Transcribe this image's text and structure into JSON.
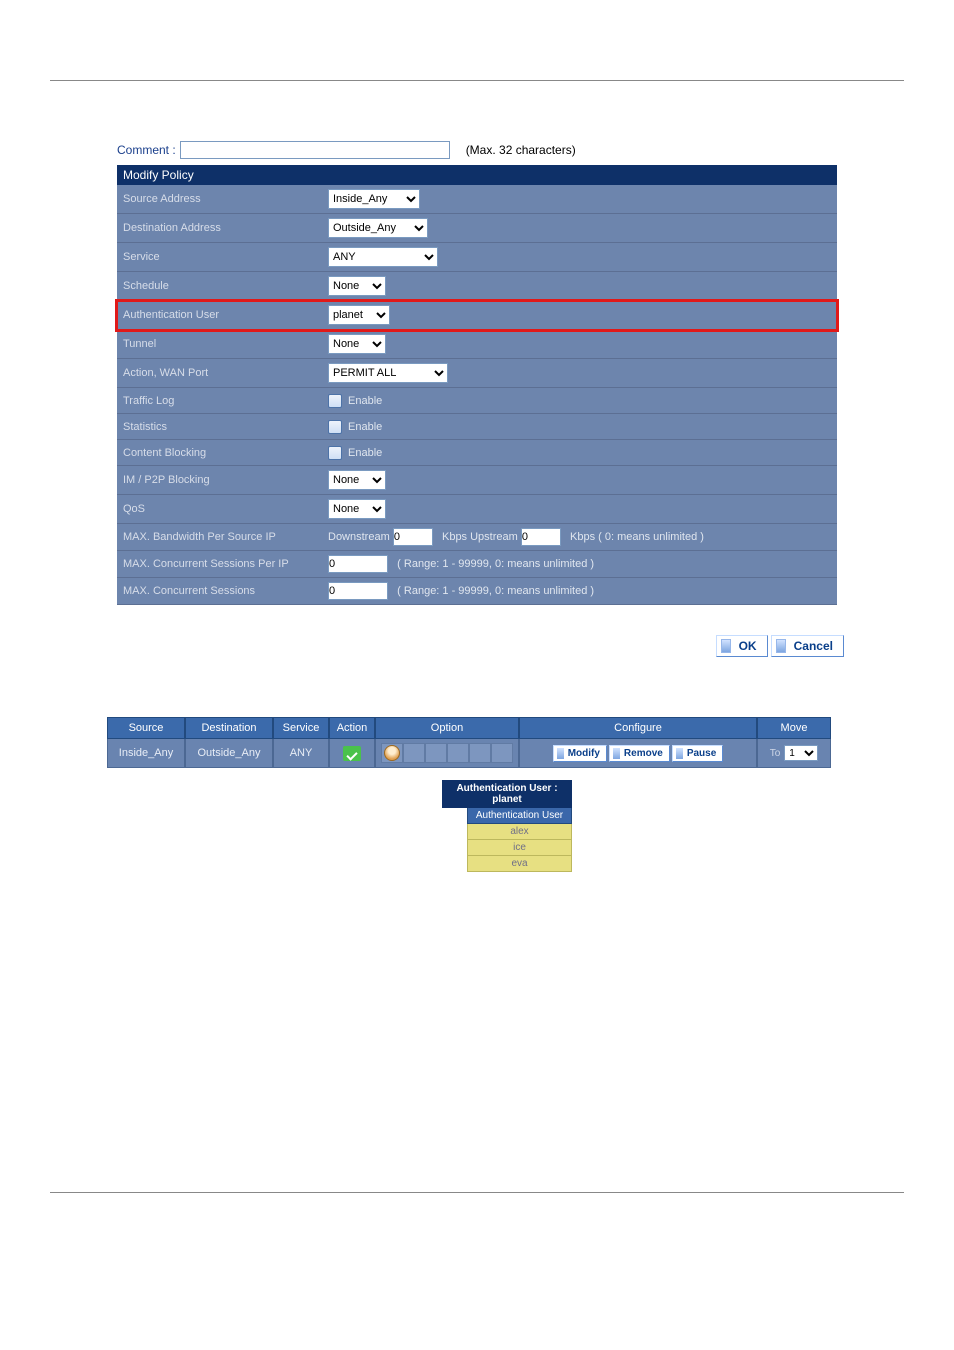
{
  "comment": {
    "label": "Comment :",
    "value": "",
    "hint": "(Max. 32 characters)"
  },
  "header": "Modify Policy",
  "fields": {
    "source_address": {
      "label": "Source Address",
      "value": "Inside_Any"
    },
    "destination_address": {
      "label": "Destination Address",
      "value": "Outside_Any"
    },
    "service": {
      "label": "Service",
      "value": "ANY"
    },
    "schedule": {
      "label": "Schedule",
      "value": "None"
    },
    "auth_user": {
      "label": "Authentication User",
      "value": "planet"
    },
    "tunnel": {
      "label": "Tunnel",
      "value": "None"
    },
    "action_wan": {
      "label": "Action, WAN Port",
      "value": "PERMIT ALL"
    },
    "traffic_log": {
      "label": "Traffic Log",
      "check_label": "Enable"
    },
    "statistics": {
      "label": "Statistics",
      "check_label": "Enable"
    },
    "content_blocking": {
      "label": "Content Blocking",
      "check_label": "Enable"
    },
    "im_p2p": {
      "label": "IM / P2P Blocking",
      "value": "None"
    },
    "qos": {
      "label": "QoS",
      "value": "None"
    },
    "max_bw": {
      "label": "MAX. Bandwidth Per Source IP",
      "down_label": "Downstream",
      "down_val": "0",
      "up_label": "Kbps Upstream",
      "up_val": "0",
      "suffix": "Kbps ( 0: means unlimited )"
    },
    "max_sess_ip": {
      "label": "MAX. Concurrent Sessions Per IP",
      "value": "0",
      "hint": "( Range: 1 - 99999, 0: means unlimited )"
    },
    "max_sess": {
      "label": "MAX. Concurrent Sessions",
      "value": "0",
      "hint": "( Range: 1 - 99999, 0: means unlimited )"
    }
  },
  "buttons": {
    "ok": "OK",
    "cancel": "Cancel"
  },
  "policy_table": {
    "headers": {
      "source": "Source",
      "destination": "Destination",
      "service": "Service",
      "action": "Action",
      "option": "Option",
      "configure": "Configure",
      "move": "Move"
    },
    "row": {
      "source": "Inside_Any",
      "destination": "Outside_Any",
      "service": "ANY",
      "configure": {
        "modify": "Modify",
        "remove": "Remove",
        "pause": "Pause"
      },
      "move": {
        "to_label": "To",
        "value": "1"
      }
    }
  },
  "tooltip": {
    "title": "Authentication User : planet",
    "header": "Authentication User",
    "users": [
      "alex",
      "ice",
      "eva"
    ]
  }
}
